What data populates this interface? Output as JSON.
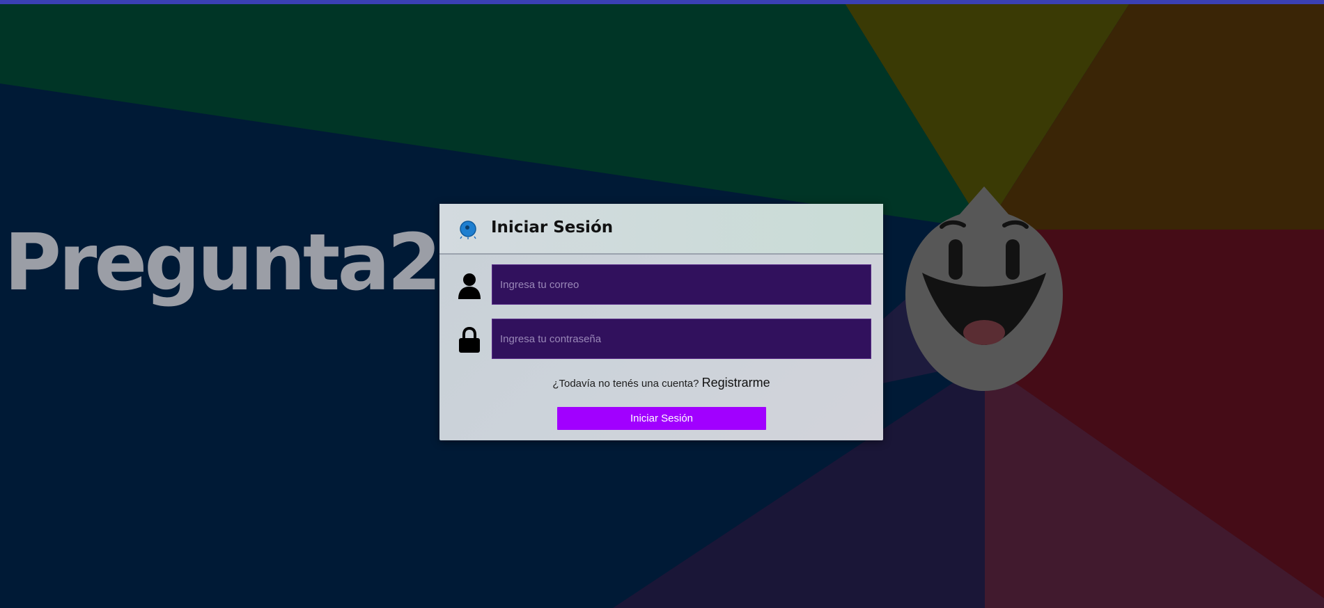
{
  "colors": {
    "top_bar": "#3a40b3",
    "card_background": "#ccd3da",
    "input_background": "#31115d",
    "button_background": "#a100ff",
    "logo_text": "#9b9ea6"
  },
  "background": {
    "logo_text": "Pregunta2",
    "mascot_icon": "smiling-drop-mascot-icon"
  },
  "login": {
    "header_icon": "globe-logo-icon",
    "title": "Iniciar Sesión",
    "email": {
      "icon": "user-icon",
      "placeholder": "Ingresa tu correo",
      "value": ""
    },
    "password": {
      "icon": "lock-icon",
      "placeholder": "Ingresa tu contraseña",
      "value": ""
    },
    "register_prompt": "¿Todavía no tenés una cuenta?",
    "register_link": "Registrarme",
    "submit_label": "Iniciar Sesión"
  }
}
